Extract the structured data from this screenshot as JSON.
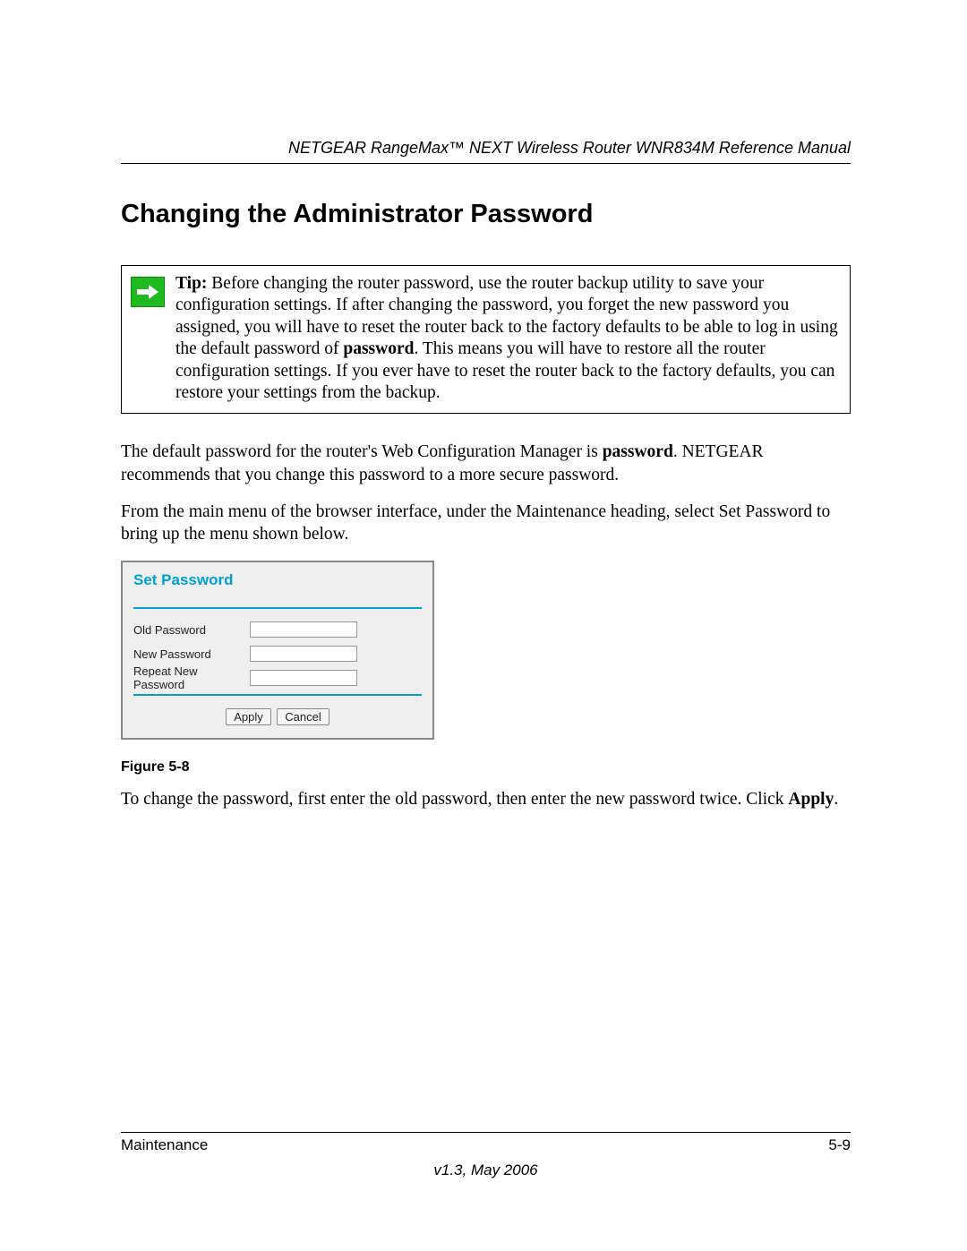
{
  "header": {
    "running": "NETGEAR RangeMax™ NEXT Wireless Router WNR834M Reference Manual"
  },
  "title": "Changing the Administrator Password",
  "tip": {
    "label": "Tip:",
    "text_before": " Before changing the router password, use the router backup utility to save your configuration settings. If after changing the password, you forget the new password you assigned, you will have to reset the router back to the factory defaults to be able to log in using the default password of ",
    "bold_word": "password",
    "text_after": ". This means you will have to restore all the router configuration settings. If you ever have to reset the router back to the factory defaults, you can restore your settings from the backup."
  },
  "para1": {
    "before": "The default password for the router's Web Configuration Manager is ",
    "bold": "password",
    "after": ". NETGEAR recommends that you change this password to a more secure password."
  },
  "para2": "From the main menu of the browser interface, under the Maintenance heading, select Set Password to bring up the menu shown below.",
  "dialog": {
    "title": "Set Password",
    "fields": {
      "old": "Old Password",
      "new": "New Password",
      "repeat": "Repeat New Password"
    },
    "buttons": {
      "apply": "Apply",
      "cancel": "Cancel"
    }
  },
  "figure_caption": "Figure 5-8",
  "para3": {
    "before": "To change the password, first enter the old password, then enter the new password twice. Click ",
    "bold": "Apply",
    "after": "."
  },
  "footer": {
    "section": "Maintenance",
    "page": "5-9",
    "version": "v1.3, May 2006"
  }
}
